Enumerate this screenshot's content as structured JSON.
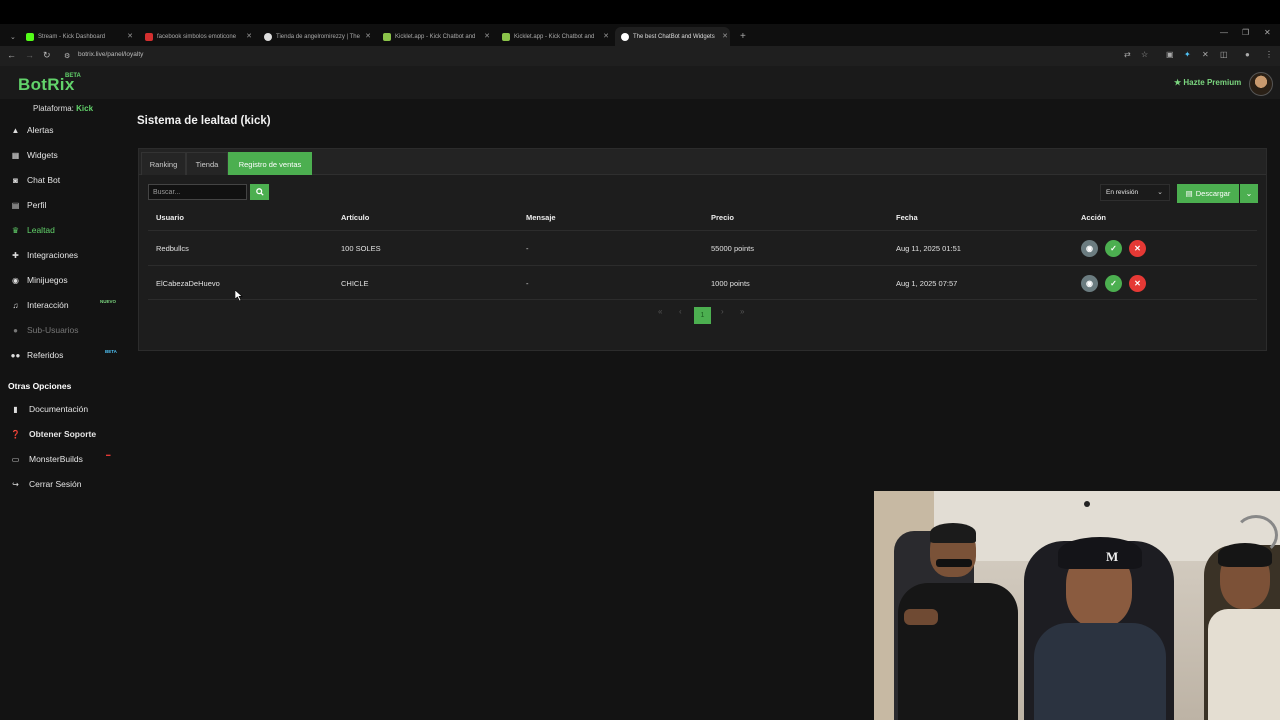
{
  "browser": {
    "tabs": [
      {
        "title": "Stream - Kick Dashboard",
        "fav_color": "#53fc18"
      },
      {
        "title": "facebook simbolos emoticone",
        "fav_color": "#d32f2f"
      },
      {
        "title": "Tienda de angelromirezzy | The",
        "fav_color": "#dddddd"
      },
      {
        "title": "Kicklet.app - Kick Chatbot and",
        "fav_color": "#8bc34a"
      },
      {
        "title": "Kicklet.app - Kick Chatbot and",
        "fav_color": "#8bc34a"
      },
      {
        "title": "The best ChatBot and Widgets",
        "fav_color": "#ffffff"
      }
    ],
    "url": "botrix.live/panel/loyalty"
  },
  "header": {
    "logo": "BotRix",
    "logo_badge": "BETA",
    "premium_label": "Hazte Premium"
  },
  "sidebar": {
    "platform_label": "Plataforma:",
    "platform_value": "Kick",
    "items": [
      {
        "label": "Alertas",
        "icon": "warning-icon"
      },
      {
        "label": "Widgets",
        "icon": "grid-icon"
      },
      {
        "label": "Chat Bot",
        "icon": "robot-icon"
      },
      {
        "label": "Perfil",
        "icon": "id-card-icon"
      },
      {
        "label": "Lealtad",
        "icon": "trophy-icon"
      },
      {
        "label": "Integraciones",
        "icon": "puzzle-icon"
      },
      {
        "label": "Minijuegos",
        "icon": "gamepad-icon"
      },
      {
        "label": "Interacción",
        "icon": "music-icon",
        "badge": "NUEVO"
      },
      {
        "label": "Sub-Usuarios",
        "icon": "users-icon"
      },
      {
        "label": "Referidos",
        "icon": "users-icon",
        "badge": "BETA"
      }
    ],
    "other_section": "Otras Opciones",
    "other_items": [
      {
        "label": "Documentación",
        "icon": "book-icon"
      },
      {
        "label": "Obtener Soporte",
        "icon": "help-icon"
      },
      {
        "label": "MonsterBuilds",
        "icon": "monitor-icon"
      },
      {
        "label": "Cerrar Sesión",
        "icon": "logout-icon"
      }
    ]
  },
  "main": {
    "title": "Sistema de lealtad (kick)",
    "tabs": [
      "Ranking",
      "Tienda",
      "Registro de ventas"
    ],
    "search_placeholder": "Buscar...",
    "status_filter": "En revisión",
    "download_label": "Descargar",
    "columns": [
      "Usuario",
      "Artículo",
      "Mensaje",
      "Precio",
      "Fecha",
      "Acción"
    ],
    "rows": [
      {
        "user": "Redbullcs",
        "item": "100 SOLES",
        "message": "-",
        "price": "55000 points",
        "date": "Aug 11, 2025 01:51"
      },
      {
        "user": "ElCabezaDeHuevo",
        "item": "CHICLE",
        "message": "-",
        "price": "1000 points",
        "date": "Aug 1, 2025 07:57"
      }
    ],
    "pagination": {
      "first": "«",
      "prev": "‹",
      "current": "1",
      "next": "›",
      "last": "»"
    }
  },
  "colors": {
    "accent": "#4caf50",
    "danger": "#e53935",
    "neutral": "#6b7c80"
  }
}
